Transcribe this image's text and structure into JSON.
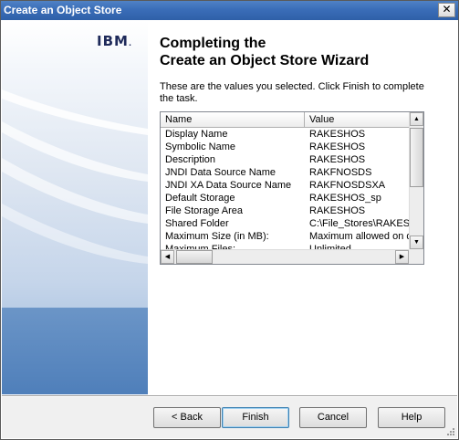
{
  "window": {
    "title": "Create an Object Store",
    "close_glyph": "✕"
  },
  "brand": {
    "logo_text": "IBM",
    "logo_mark": "."
  },
  "heading": {
    "line1": "Completing the",
    "line2": "Create an Object Store Wizard"
  },
  "description": "These are the values you selected. Click Finish to complete the task.",
  "list": {
    "columns": [
      "Name",
      "Value"
    ],
    "rows": [
      {
        "name": "Display Name",
        "value": "RAKESHOS"
      },
      {
        "name": "Symbolic Name",
        "value": "RAKESHOS"
      },
      {
        "name": "Description",
        "value": "RAKESHOS"
      },
      {
        "name": "JNDI Data Source Name",
        "value": "RAKFNOSDS"
      },
      {
        "name": "JNDI XA Data Source Name",
        "value": "RAKFNOSDSXA"
      },
      {
        "name": "Default Storage",
        "value": "RAKESHOS_sp"
      },
      {
        "name": "File Storage Area",
        "value": "RAKESHOS"
      },
      {
        "name": "Shared Folder",
        "value": "C:\\File_Stores\\RAKESH"
      },
      {
        "name": "Maximum Size (in MB):",
        "value": "Maximum allowed on de"
      },
      {
        "name": "Maximum Files:",
        "value": "Unlimited"
      }
    ]
  },
  "buttons": {
    "back": "< Back",
    "finish": "Finish",
    "cancel": "Cancel",
    "help": "Help"
  }
}
